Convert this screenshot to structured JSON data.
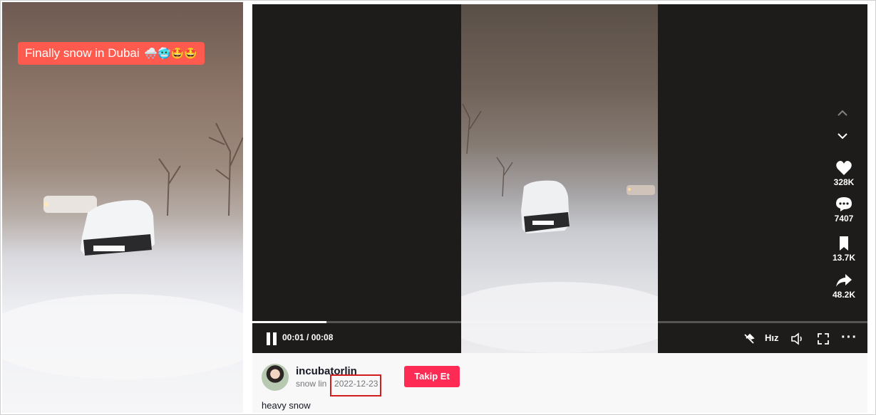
{
  "thumbnail": {
    "caption": "Finally snow in Dubai",
    "caption_emojis": "🌨️🥶🤩🤩"
  },
  "player": {
    "time": "00:01 / 00:08",
    "progress": 0.12,
    "speed_label": "Hız"
  },
  "actions": {
    "likes": "328K",
    "comments": "7407",
    "saves": "13.7K",
    "shares": "48.2K"
  },
  "author": {
    "username": "incubatorlin",
    "display_name": "snow lin",
    "separator": " · ",
    "date": "2022-12-23",
    "follow_label": "Takip Et"
  },
  "description": "heavy snow",
  "icons": [
    "pause-icon",
    "pip-icon",
    "volume-icon",
    "fullscreen-icon",
    "more-icon",
    "chevron-up-icon",
    "chevron-down-icon",
    "heart-icon",
    "comment-icon",
    "bookmark-icon",
    "share-icon"
  ],
  "colors": {
    "follow": "#fe2c55",
    "highlight_box": "#d11d1d",
    "caption_bg": "#ff5a4e"
  }
}
